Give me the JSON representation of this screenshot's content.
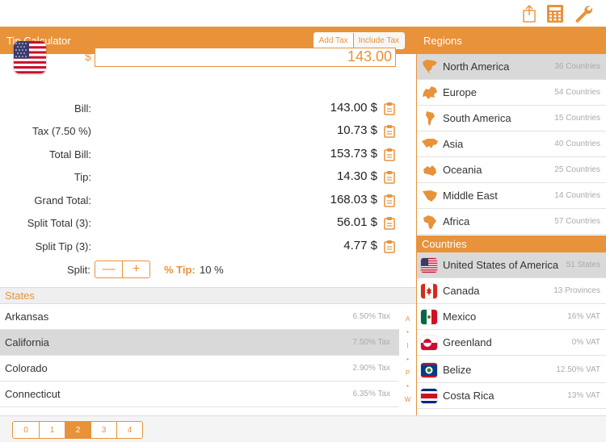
{
  "colors": {
    "accent": "#e8923a",
    "selected_row": "#d9d9d9",
    "muted_text": "#aaaaaa"
  },
  "topbar": {
    "icons": [
      "share-icon",
      "calculator-icon",
      "wrench-icon"
    ]
  },
  "calculator": {
    "title": "Tip Calculator",
    "tax_mode": {
      "add_label": "Add Tax",
      "include_label": "Include Tax",
      "selected": "Add Tax"
    },
    "currency_symbol": "$",
    "amount": "143.00",
    "rows": [
      {
        "label": "Bill:",
        "value": "143.00 $"
      },
      {
        "label": "Tax (7.50 %)",
        "value": "10.73 $"
      },
      {
        "label": "Total Bill:",
        "value": "153.73 $"
      },
      {
        "label": "Tip:",
        "value": "14.30 $"
      },
      {
        "label": "Grand Total:",
        "value": "168.03 $"
      },
      {
        "label": "Split Total (3):",
        "value": "56.01 $"
      },
      {
        "label": "Split Tip (3):",
        "value": "4.77 $"
      }
    ],
    "split_label": "Split:",
    "stepper_minus": "—",
    "stepper_plus": "+",
    "tip_label": "% Tip:",
    "tip_value": "10 %"
  },
  "states": {
    "header": "States",
    "items": [
      {
        "name": "Arkansas",
        "tax": "6.50% Tax",
        "selected": false
      },
      {
        "name": "California",
        "tax": "7.50% Tax",
        "selected": true
      },
      {
        "name": "Colorado",
        "tax": "2.90% Tax",
        "selected": false
      },
      {
        "name": "Connecticut",
        "tax": "6.35% Tax",
        "selected": false
      }
    ],
    "index": [
      "A",
      "•",
      "I",
      "•",
      "P",
      "•",
      "W"
    ]
  },
  "pager": {
    "pages": [
      "0",
      "1",
      "2",
      "3",
      "4"
    ],
    "selected": "2"
  },
  "regions": {
    "header": "Regions",
    "items": [
      {
        "name": "North America",
        "count": "36 Countries",
        "icon": "north-america-icon",
        "selected": true
      },
      {
        "name": "Europe",
        "count": "54 Countries",
        "icon": "europe-icon",
        "selected": false
      },
      {
        "name": "South America",
        "count": "15 Countries",
        "icon": "south-america-icon",
        "selected": false
      },
      {
        "name": "Asia",
        "count": "40 Countries",
        "icon": "asia-icon",
        "selected": false
      },
      {
        "name": "Oceania",
        "count": "25 Countries",
        "icon": "oceania-icon",
        "selected": false
      },
      {
        "name": "Middle East",
        "count": "14 Countries",
        "icon": "middle-east-icon",
        "selected": false
      },
      {
        "name": "Africa",
        "count": "57 Countries",
        "icon": "africa-icon",
        "selected": false
      }
    ]
  },
  "countries": {
    "header": "Countries",
    "items": [
      {
        "name": "United States of America",
        "detail": "51 States",
        "flag": "usa-flag-icon",
        "selected": true
      },
      {
        "name": "Canada",
        "detail": "13 Provinces",
        "flag": "canada-flag-icon",
        "selected": false
      },
      {
        "name": "Mexico",
        "detail": "16% VAT",
        "flag": "mexico-flag-icon",
        "selected": false
      },
      {
        "name": "Greenland",
        "detail": "0% VAT",
        "flag": "greenland-flag-icon",
        "selected": false
      },
      {
        "name": "Belize",
        "detail": "12.50% VAT",
        "flag": "belize-flag-icon",
        "selected": false
      },
      {
        "name": "Costa Rica",
        "detail": "13% VAT",
        "flag": "costa-rica-flag-icon",
        "selected": false
      }
    ]
  }
}
